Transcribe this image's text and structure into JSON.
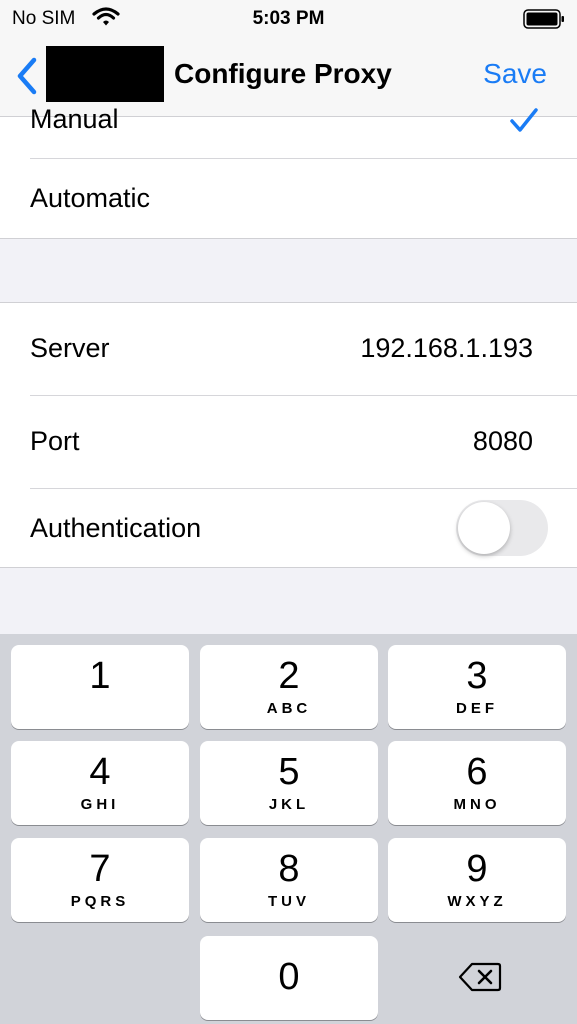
{
  "status_bar": {
    "carrier": "No SIM",
    "time": "5:03 PM"
  },
  "nav": {
    "title": "Configure Proxy",
    "save_label": "Save"
  },
  "mode_options": [
    {
      "label": "Manual",
      "selected": true
    },
    {
      "label": "Automatic",
      "selected": false
    }
  ],
  "settings": {
    "server_label": "Server",
    "server_value": "192.168.1.193",
    "port_label": "Port",
    "port_value": "8080",
    "auth_label": "Authentication",
    "auth_enabled": false
  },
  "keypad": [
    {
      "num": "1",
      "letters": ""
    },
    {
      "num": "2",
      "letters": "ABC"
    },
    {
      "num": "3",
      "letters": "DEF"
    },
    {
      "num": "4",
      "letters": "GHI"
    },
    {
      "num": "5",
      "letters": "JKL"
    },
    {
      "num": "6",
      "letters": "MNO"
    },
    {
      "num": "7",
      "letters": "PQRS"
    },
    {
      "num": "8",
      "letters": "TUV"
    },
    {
      "num": "9",
      "letters": "WXYZ"
    },
    {
      "num": "0",
      "letters": ""
    }
  ],
  "colors": {
    "accent": "#1a7cf5",
    "background": "#f2f2f7",
    "keyboard": "#d1d3d9"
  }
}
